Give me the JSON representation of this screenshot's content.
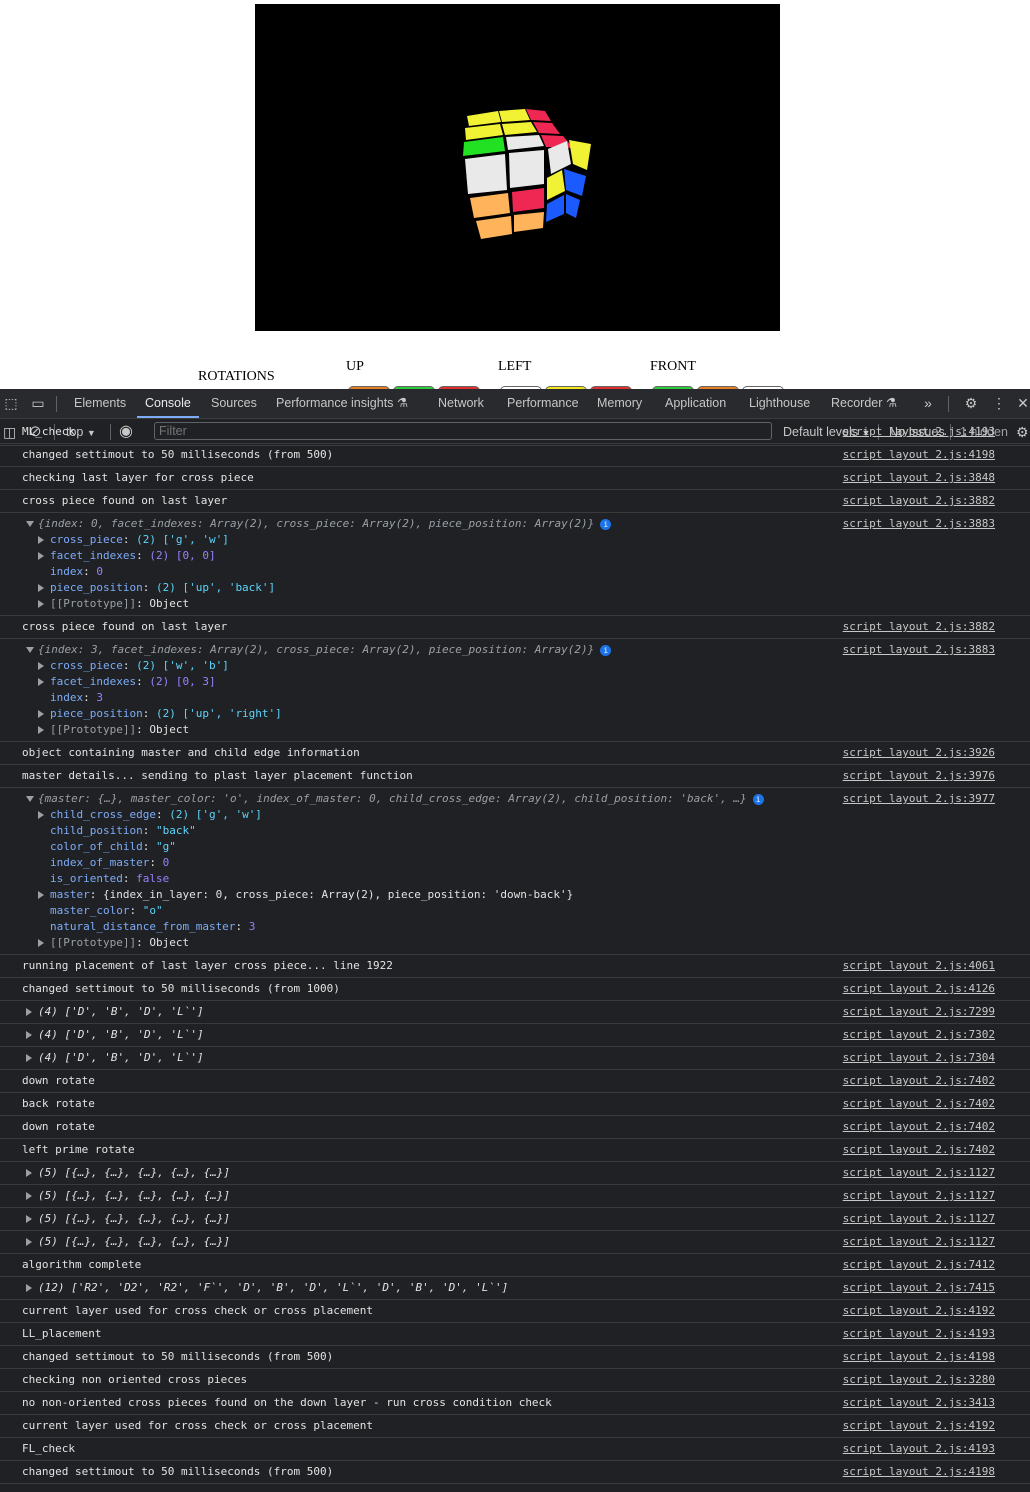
{
  "page": {
    "rotations_label": "ROTATIONS",
    "up_label": "UP",
    "left_label": "LEFT",
    "front_label": "FRONT",
    "rotation_button_colors": {
      "up": [
        "#e67e22",
        "#2ecc40",
        "#e03030"
      ],
      "left": [
        "#ffffff",
        "#f1e71a",
        "#e03030"
      ],
      "front": [
        "#2ecc40",
        "#e67e22",
        "#ffffff"
      ]
    }
  },
  "cube": {
    "colors": {
      "white": "#e9e9e9",
      "green": "#22e022",
      "yellow": "#f2f234",
      "red": "#ef2853",
      "blue": "#1a5aff",
      "orange": "#ffb35a"
    }
  },
  "devtools": {
    "tabs": [
      "Elements",
      "Console",
      "Sources",
      "Performance insights",
      "Network",
      "Performance",
      "Memory",
      "Application",
      "Lighthouse",
      "Recorder"
    ],
    "active_tab": "Console",
    "context": "top",
    "filter_placeholder": "Filter",
    "levels": "Default levels",
    "issues": "No Issues",
    "hidden": "1 hidden"
  },
  "console": [
    {
      "text": "ML_check",
      "src": "script layout 2.js:4193"
    },
    {
      "text": "changed settimout to 50 milliseconds (from 500)",
      "src": "script layout 2.js:4198"
    },
    {
      "text": "checking last layer for cross piece",
      "src": "script layout 2.js:3848"
    },
    {
      "text": "cross piece found on last layer",
      "src": "script layout 2.js:3882"
    },
    {
      "obj": "obj1",
      "src": "script layout 2.js:3883"
    },
    {
      "text": "cross piece found on last layer",
      "src": "script layout 2.js:3882"
    },
    {
      "obj": "obj2",
      "src": "script layout 2.js:3883"
    },
    {
      "text": "object containing master and child edge information",
      "src": "script layout 2.js:3926"
    },
    {
      "text": "master details... sending to plast layer placement function",
      "src": "script layout 2.js:3976"
    },
    {
      "obj": "obj3",
      "src": "script layout 2.js:3977"
    },
    {
      "text": "running placement of last layer cross piece... line 1922",
      "src": "script layout 2.js:4061"
    },
    {
      "text": "changed settimout to 50 milliseconds (from 1000)",
      "src": "script layout 2.js:4126"
    },
    {
      "arr": "(4) ['D', 'B', 'D', 'L`']",
      "src": "script layout 2.js:7299"
    },
    {
      "arr": "(4) ['D', 'B', 'D', 'L`']",
      "src": "script layout 2.js:7302"
    },
    {
      "arr": "(4) ['D', 'B', 'D', 'L`']",
      "src": "script layout 2.js:7304"
    },
    {
      "text": "down rotate",
      "src": "script layout 2.js:7402"
    },
    {
      "text": "back rotate",
      "src": "script layout 2.js:7402"
    },
    {
      "text": "down rotate",
      "src": "script layout 2.js:7402"
    },
    {
      "text": "left prime rotate",
      "src": "script layout 2.js:7402"
    },
    {
      "arr": "(5) [{…}, {…}, {…}, {…}, {…}]",
      "src": "script layout 2.js:1127"
    },
    {
      "arr": "(5) [{…}, {…}, {…}, {…}, {…}]",
      "src": "script layout 2.js:1127"
    },
    {
      "arr": "(5) [{…}, {…}, {…}, {…}, {…}]",
      "src": "script layout 2.js:1127"
    },
    {
      "arr": "(5) [{…}, {…}, {…}, {…}, {…}]",
      "src": "script layout 2.js:1127"
    },
    {
      "text": "algorithm complete",
      "src": "script layout 2.js:7412"
    },
    {
      "arr": "(12) ['R2', 'D2', 'R2', 'F`', 'D', 'B', 'D', 'L`', 'D', 'B', 'D', 'L`']",
      "src": "script layout 2.js:7415"
    },
    {
      "text": "current layer used for cross check or cross placement",
      "src": "script layout 2.js:4192"
    },
    {
      "text": "LL_placement",
      "src": "script layout 2.js:4193"
    },
    {
      "text": "changed settimout to 50 milliseconds (from 500)",
      "src": "script layout 2.js:4198"
    },
    {
      "text": "checking non oriented cross pieces",
      "src": "script layout 2.js:3280"
    },
    {
      "text": "no non-oriented cross pieces found on the down layer - run cross condition check",
      "src": "script layout 2.js:3413"
    },
    {
      "text": "current layer used for cross check or cross placement",
      "src": "script layout 2.js:4192"
    },
    {
      "text": "FL_check",
      "src": "script layout 2.js:4193"
    },
    {
      "text": "changed settimout to 50 milliseconds (from 500)",
      "src": "script layout 2.js:4198"
    }
  ],
  "obj1": {
    "summary": "{index: 0, facet_indexes: Array(2), cross_piece: Array(2), piece_position: Array(2)}",
    "cross_piece": "(2) ['g', 'w']",
    "facet_indexes": "(2) [0, 0]",
    "index": "0",
    "piece_position": "(2) ['up', 'back']",
    "prototype": "Object"
  },
  "obj2": {
    "summary": "{index: 3, facet_indexes: Array(2), cross_piece: Array(2), piece_position: Array(2)}",
    "cross_piece": "(2) ['w', 'b']",
    "facet_indexes": "(2) [0, 3]",
    "index": "3",
    "piece_position": "(2) ['up', 'right']",
    "prototype": "Object"
  },
  "obj3": {
    "summary": "{master: {…}, master_color: 'o', index_of_master: 0, child_cross_edge: Array(2), child_position: 'back', …}",
    "child_cross_edge": "(2) ['g', 'w']",
    "child_position": "\"back\"",
    "color_of_child": "\"g\"",
    "index_of_master": "0",
    "is_oriented": "false",
    "master": "{index_in_layer: 0, cross_piece: Array(2), piece_position: 'down-back'}",
    "master_color": "\"o\"",
    "natural_distance_from_master": "3",
    "prototype": "Object"
  }
}
